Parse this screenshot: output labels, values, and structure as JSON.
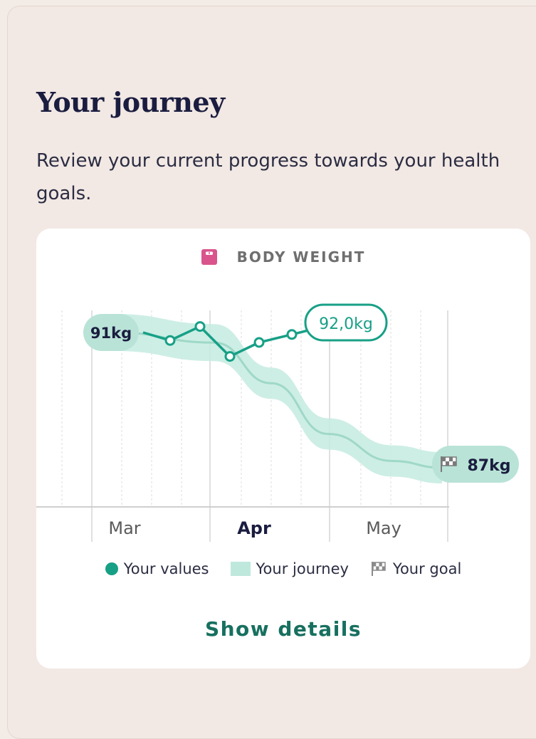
{
  "card": {
    "title": "Your journey",
    "subtitle": "Review your current progress towards your health goals."
  },
  "chart": {
    "icon": "scale-icon",
    "title": "BODY WEIGHT",
    "start_label": "91kg",
    "current_label": "92,0kg",
    "goal_label": "87kg",
    "months": [
      "Mar",
      "Apr",
      "May"
    ],
    "highlighted_month": "Apr"
  },
  "chart_data": {
    "type": "line",
    "title": "BODY WEIGHT",
    "x_labels": [
      "Mar",
      "Apr",
      "May"
    ],
    "series": [
      {
        "name": "Your values",
        "x": [
          "Mar 1",
          "Mar 11",
          "Mar 20",
          "Apr 1",
          "Apr 10",
          "Apr 20",
          "May 1"
        ],
        "values": [
          91.0,
          90.6,
          91.3,
          89.8,
          90.5,
          90.9,
          92.0
        ]
      },
      {
        "name": "Your journey",
        "x": [
          "Mar 1",
          "Apr 1",
          "Apr 15",
          "May 1",
          "May 20",
          "Jun 1"
        ],
        "values": [
          91.0,
          90.7,
          89.5,
          88.0,
          87.2,
          87.0
        ]
      }
    ],
    "goal": 87,
    "colors": {
      "values": "#17a086",
      "journey_band": "#bfe8dd",
      "journey_line": "#a4dbcd",
      "label_fill": "#b9e3d7"
    }
  },
  "legend": {
    "values_label": "Your values",
    "journey_label": "Your journey",
    "goal_label": "Your goal"
  },
  "actions": {
    "show_details": "Show details"
  }
}
